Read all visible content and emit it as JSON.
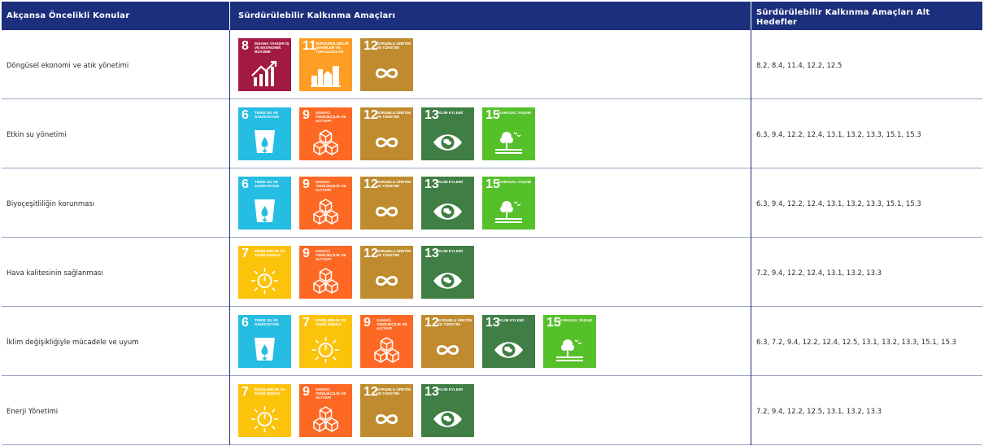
{
  "header": {
    "col1": "Akçansa Öncelikli Konular",
    "col2": "Sürdürülebilir Kalkınma Amaçları",
    "col3": "Sürdürülebilir Kalkınma Amaçları Alt Hedefler"
  },
  "sdg_goals": {
    "6": {
      "number": "6",
      "title": "TEMİZ SU VE SANİTASYON",
      "color": "#26bde2",
      "icon": "water-drop-icon"
    },
    "7": {
      "number": "7",
      "title": "ERİŞİLEBİLİR VE TEMİZ ENERJİ",
      "color": "#fcc30b",
      "icon": "sun-power-icon"
    },
    "8": {
      "number": "8",
      "title": "İNSANA YAKIŞIR İŞ VE EKONOMİK BÜYÜME",
      "color": "#a21942",
      "icon": "growth-chart-icon"
    },
    "9": {
      "number": "9",
      "title": "SANAYİ, YENİLİKÇİLİK VE ALTYAPI",
      "color": "#fd6925",
      "icon": "cubes-icon"
    },
    "11": {
      "number": "11",
      "title": "SÜRDÜRÜLEBİLİR ŞEHİRLER VE TOPLULUKLAR",
      "color": "#fd9d24",
      "icon": "city-icon"
    },
    "12": {
      "number": "12",
      "title": "SORUMLU ÜRETİM VE TÜKETİM",
      "color": "#bf8b2e",
      "icon": "infinity-icon"
    },
    "13": {
      "number": "13",
      "title": "İKLİM EYLEMİ",
      "color": "#3f7e44",
      "icon": "eye-globe-icon"
    },
    "15": {
      "number": "15",
      "title": "KARASAL YAŞAM",
      "color": "#56c02b",
      "icon": "tree-birds-icon"
    }
  },
  "rows": [
    {
      "topic": "Döngüsel ekonomi ve atık yönetimi",
      "sdgs": [
        "8",
        "11",
        "12"
      ],
      "targets": "8.2, 8.4, 11.4, 12.2, 12.5"
    },
    {
      "topic": "Etkin su yönetimi",
      "sdgs": [
        "6",
        "9",
        "12",
        "13",
        "15"
      ],
      "targets": "6.3, 9.4, 12.2, 12.4, 13.1, 13.2, 13.3, 15.1, 15.3"
    },
    {
      "topic": "Biyoçeşitliliğin korunması",
      "sdgs": [
        "6",
        "9",
        "12",
        "13",
        "15"
      ],
      "targets": "6.3, 9.4, 12.2, 12.4, 13.1, 13.2, 13.3, 15.1, 15.3"
    },
    {
      "topic": "Hava kalitesinin sağlanması",
      "sdgs": [
        "7",
        "9",
        "12",
        "13"
      ],
      "targets": "7.2, 9.4, 12.2, 12.4, 13.1, 13.2, 13.3"
    },
    {
      "topic": "İklim değişikliğiyle mücadele ve uyum",
      "sdgs": [
        "6",
        "7",
        "9",
        "12",
        "13",
        "15"
      ],
      "targets": "6.3, 7.2, 9.4, 12.2, 12.4, 12.5, 13.1, 13.2, 13.3, 15.1, 15.3"
    },
    {
      "topic": "Enerji Yönetimi",
      "sdgs": [
        "7",
        "9",
        "12",
        "13"
      ],
      "targets": "7.2, 9.4, 12.2, 12.5, 13.1, 13.2, 13.3"
    }
  ]
}
